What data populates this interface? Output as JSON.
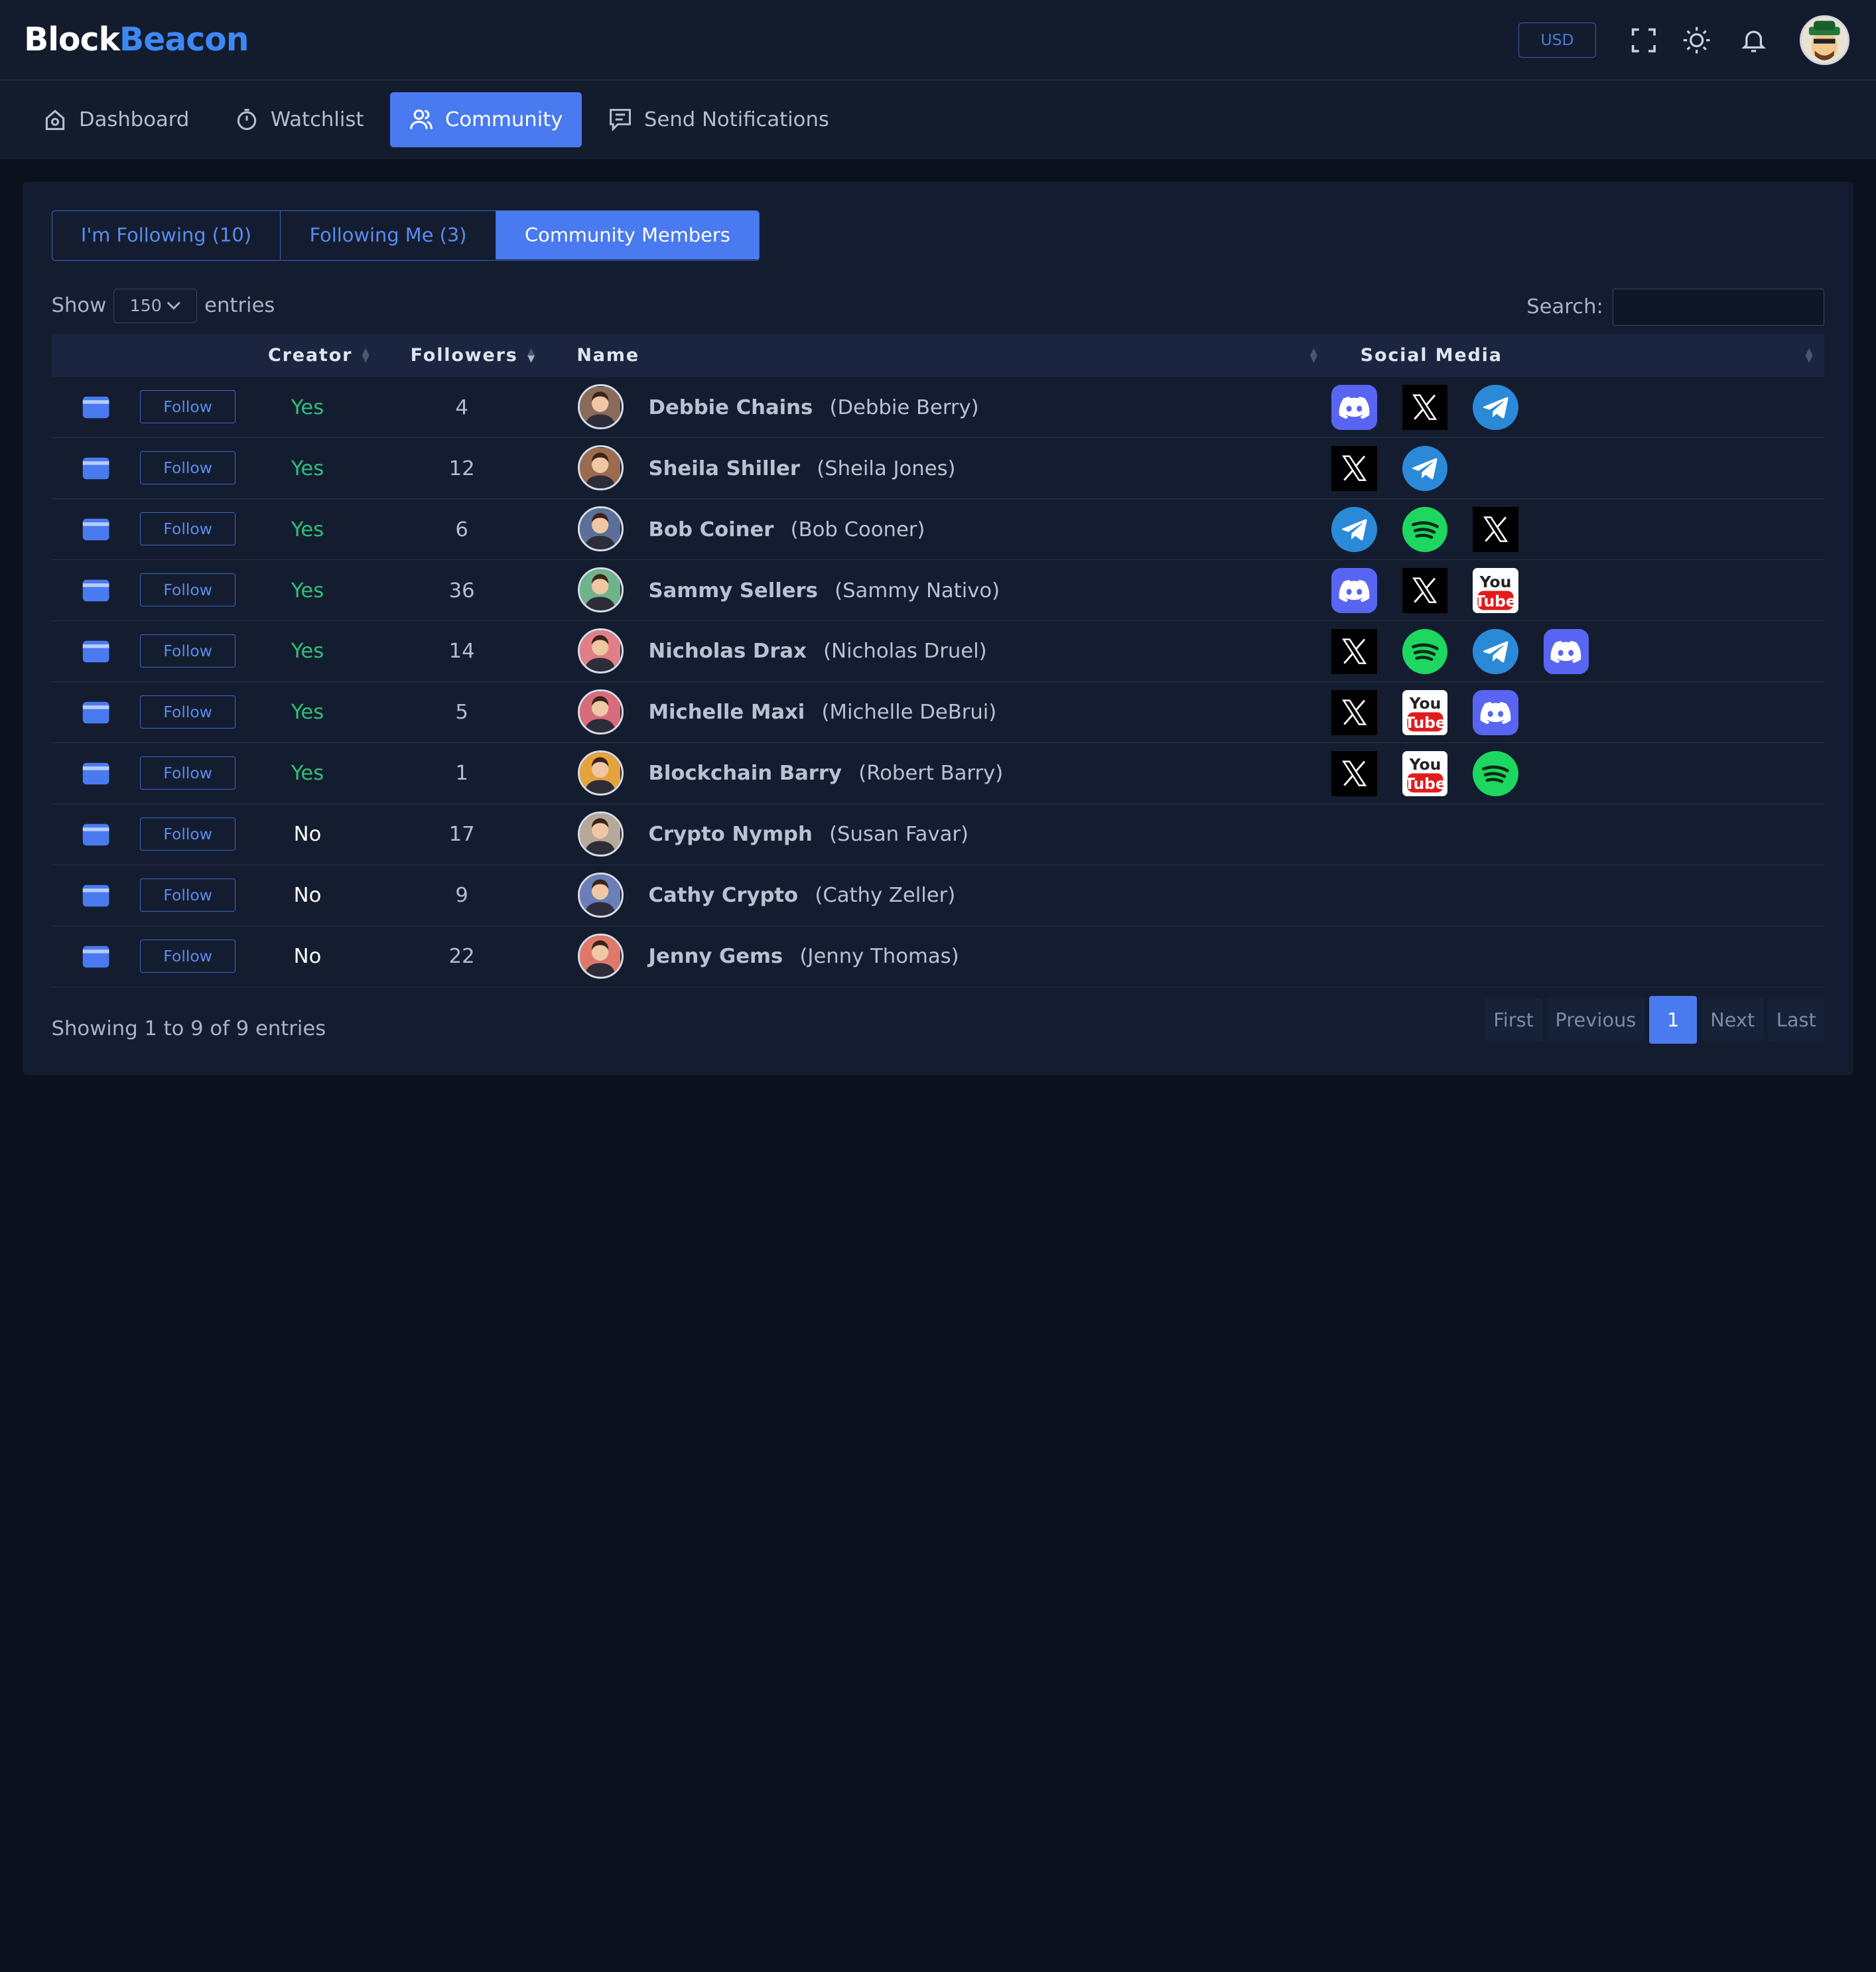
{
  "header": {
    "logo_part1": "Block",
    "logo_part2": "Beacon",
    "currency": "USD"
  },
  "nav": [
    {
      "label": "Dashboard",
      "icon": "home-icon"
    },
    {
      "label": "Watchlist",
      "icon": "stopwatch-icon"
    },
    {
      "label": "Community",
      "icon": "users-icon",
      "active": true
    },
    {
      "label": "Send Notifications",
      "icon": "message-icon"
    }
  ],
  "segments": [
    {
      "label": "I'm Following (10)"
    },
    {
      "label": "Following Me (3)"
    },
    {
      "label": "Community Members",
      "active": true
    }
  ],
  "controls": {
    "show_label": "Show",
    "entries_value": "150",
    "entries_label": "entries",
    "search_label": "Search:",
    "search_value": ""
  },
  "table": {
    "headers": {
      "creator": "Creator",
      "followers": "Followers",
      "name": "Name",
      "social": "Social Media"
    },
    "follow_label": "Follow",
    "rows": [
      {
        "creator": "Yes",
        "followers": "4",
        "name": "Debbie Chains",
        "real": "(Debbie Berry)",
        "social": [
          "discord",
          "x",
          "telegram"
        ],
        "avatar_color": "#8a6a5a"
      },
      {
        "creator": "Yes",
        "followers": "12",
        "name": "Sheila Shiller",
        "real": "(Sheila Jones)",
        "social": [
          "x",
          "telegram"
        ],
        "avatar_color": "#9a6b4f"
      },
      {
        "creator": "Yes",
        "followers": "6",
        "name": "Bob Coiner",
        "real": "(Bob Cooner)",
        "social": [
          "telegram",
          "spotify",
          "x"
        ],
        "avatar_color": "#5b6f9a"
      },
      {
        "creator": "Yes",
        "followers": "36",
        "name": "Sammy Sellers",
        "real": "(Sammy Nativo)",
        "social": [
          "discord",
          "x",
          "youtube"
        ],
        "avatar_color": "#6fb38a"
      },
      {
        "creator": "Yes",
        "followers": "14",
        "name": "Nicholas Drax",
        "real": "(Nicholas Druel)",
        "social": [
          "x",
          "spotify",
          "telegram",
          "discord"
        ],
        "avatar_color": "#e07f86"
      },
      {
        "creator": "Yes",
        "followers": "5",
        "name": "Michelle Maxi",
        "real": "(Michelle DeBrui)",
        "social": [
          "x",
          "youtube",
          "discord"
        ],
        "avatar_color": "#d96c7c"
      },
      {
        "creator": "Yes",
        "followers": "1",
        "name": "Blockchain Barry",
        "real": "(Robert Barry)",
        "social": [
          "x",
          "youtube",
          "spotify"
        ],
        "avatar_color": "#e6a23c"
      },
      {
        "creator": "No",
        "followers": "17",
        "name": "Crypto Nymph",
        "real": "(Susan Favar)",
        "social": [],
        "avatar_color": "#b8a89a"
      },
      {
        "creator": "No",
        "followers": "9",
        "name": "Cathy Crypto",
        "real": "(Cathy Zeller)",
        "social": [],
        "avatar_color": "#6a7fb8"
      },
      {
        "creator": "No",
        "followers": "22",
        "name": "Jenny Gems",
        "real": "(Jenny Thomas)",
        "social": [],
        "avatar_color": "#e0786a"
      }
    ]
  },
  "footer": {
    "info": "Showing 1 to 9 of 9 entries",
    "pager": {
      "first": "First",
      "previous": "Previous",
      "current": "1",
      "next": "Next",
      "last": "Last"
    }
  }
}
